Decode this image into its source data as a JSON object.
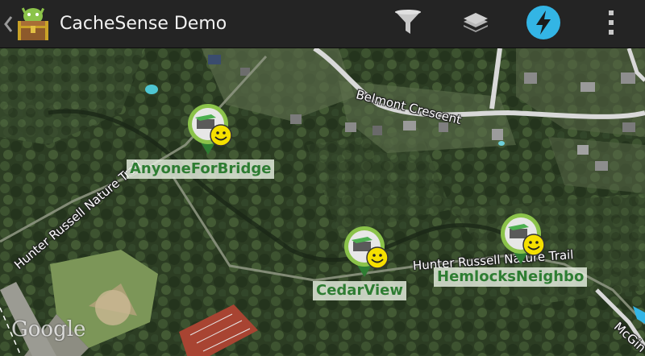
{
  "app": {
    "title": "CacheSense Demo"
  },
  "actionbar": {
    "actions": [
      {
        "name": "filter",
        "icon": "funnel-icon"
      },
      {
        "name": "layers",
        "icon": "layers-icon"
      },
      {
        "name": "live-mode",
        "icon": "lightning-icon",
        "active": true
      },
      {
        "name": "overflow-menu",
        "icon": "overflow-menu-icon"
      }
    ]
  },
  "map": {
    "roads": {
      "belmont": "Belmont Crescent",
      "hunter_west": "Hunter Russell Nature Trail",
      "hunter_east": "Hunter Russell Nature Trail",
      "mcgin": "McGin"
    },
    "caches": [
      {
        "name": "AnyoneForBridge"
      },
      {
        "name": "CedarView"
      },
      {
        "name": "HemlocksNeighbo"
      }
    ],
    "attribution": "Google"
  },
  "colors": {
    "actionbar": "#242424",
    "accent": "#33b5e5",
    "cache_label_text": "#2e7d32",
    "marker_ring": "#8bc34a"
  }
}
